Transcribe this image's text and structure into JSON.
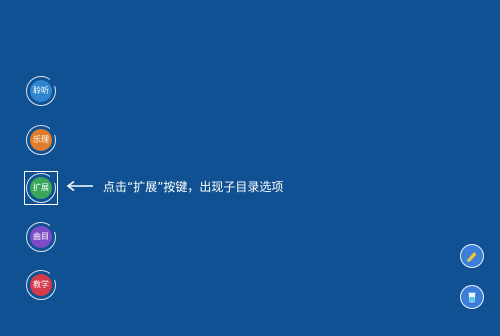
{
  "menu": {
    "items": [
      {
        "label": "聆听"
      },
      {
        "label": "乐理"
      },
      {
        "label": "扩展"
      },
      {
        "label": "曲目"
      },
      {
        "label": "教学"
      }
    ]
  },
  "hint": {
    "text": "点击“扩展”按键，出现子目录选项"
  },
  "side_buttons": {
    "top": {
      "icon": "pencil-icon"
    },
    "bottom": {
      "icon": "cup-icon"
    }
  },
  "colors": {
    "background": "#0f5192",
    "item_1": "#2f86cf",
    "item_2": "#e07c2b",
    "item_3": "#3aa65a",
    "item_4": "#7c4cc6",
    "item_5": "#d63a48",
    "side_button": "#3d7ed9"
  }
}
